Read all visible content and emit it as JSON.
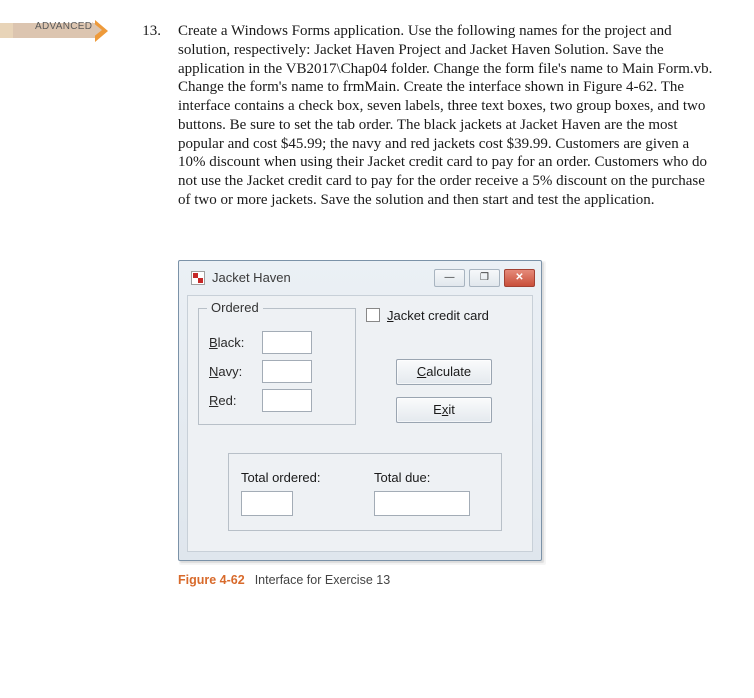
{
  "badge": {
    "label": "ADVANCED"
  },
  "exercise": {
    "number": "13.",
    "text": "Create a Windows Forms application. Use the following names for the project and solution, respectively: Jacket Haven Project and Jacket Haven Solution. Save the application in the VB2017\\Chap04 folder. Change the form file's name to Main Form.vb. Change the form's name to frmMain. Create the interface shown in Figure 4-62. The interface contains a check box, seven labels, three text boxes, two group boxes, and two buttons. Be sure to set the tab order. The black jackets at Jacket Haven are the most popular and cost $45.99; the navy and red jackets cost $39.99. Customers are given a 10% discount when using their Jacket credit card to pay for an order. Customers who do not use the Jacket credit card to pay for the order receive a 5% discount on the purchase of two or more jackets. Save the solution and then start and test the application."
  },
  "window": {
    "title": "Jacket Haven",
    "min_label": "—",
    "max_glyph": "❐",
    "close_glyph": "✕",
    "ordered": {
      "legend": "Ordered",
      "black_key": "B",
      "black_rest": "lack:",
      "navy_key": "N",
      "navy_rest": "avy:",
      "red_key": "R",
      "red_rest": "ed:"
    },
    "checkbox": {
      "key": "J",
      "rest": "acket credit card"
    },
    "buttons": {
      "calc_key": "C",
      "calc_rest": "alculate",
      "exit_pre": "E",
      "exit_key": "x",
      "exit_rest": "it"
    },
    "totals": {
      "ordered_label": "Total ordered:",
      "due_label": "Total due:"
    }
  },
  "caption": {
    "fig": "Figure 4-62",
    "text": "Interface for Exercise 13"
  }
}
